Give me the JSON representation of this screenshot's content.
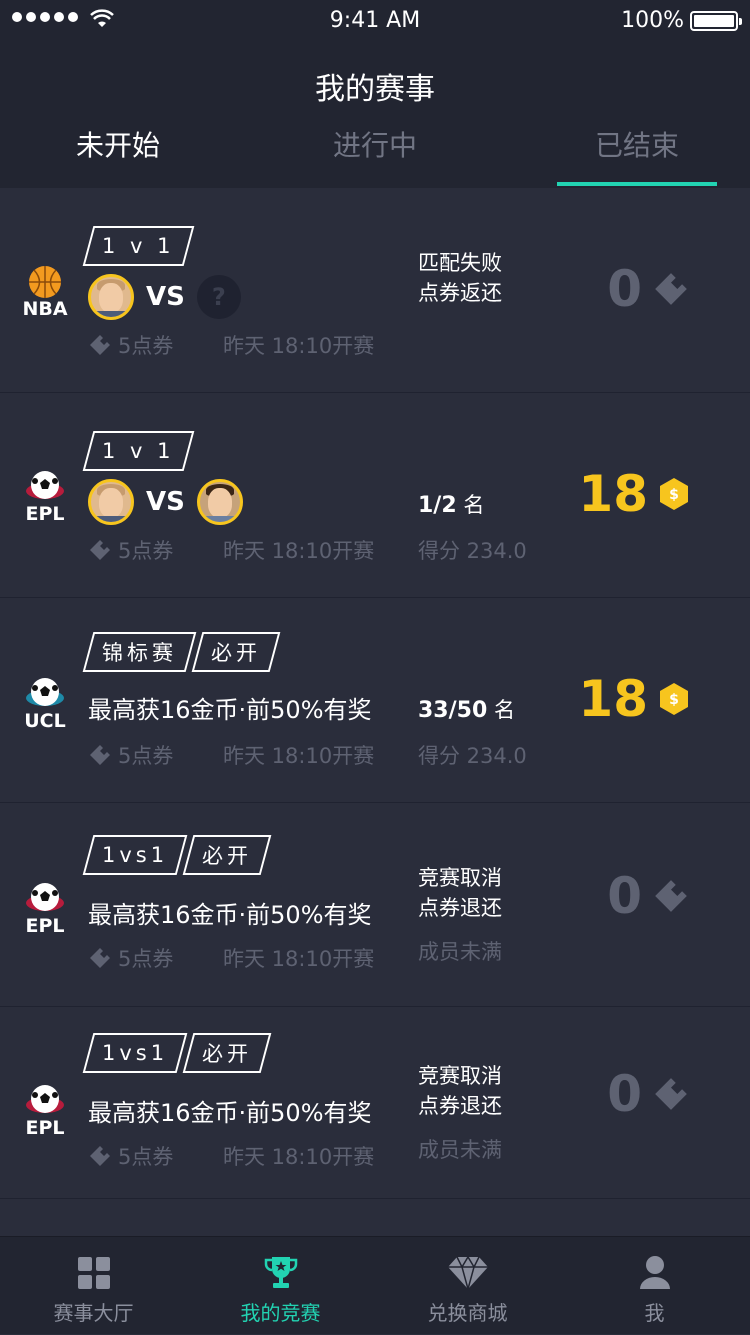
{
  "status": {
    "time": "9:41 AM",
    "battery": "100%"
  },
  "header": {
    "title": "我的赛事"
  },
  "tabs": [
    {
      "label": "未开始"
    },
    {
      "label": "进行中"
    },
    {
      "label": "已结束"
    }
  ],
  "rows": [
    {
      "league": "NBA",
      "tags": [
        "1 v 1"
      ],
      "players": "VS",
      "ticket": "5点券",
      "time": "昨天 18:10开赛",
      "result_line1": "匹配失败",
      "result_line2": "点券返还",
      "reward": "0"
    },
    {
      "league": "EPL",
      "tags": [
        "1 v 1"
      ],
      "players": "VS",
      "ticket": "5点券",
      "time": "昨天 18:10开赛",
      "rank": "1/2",
      "rank_unit": "名",
      "score": "得分 234.0",
      "reward": "18",
      "coin_symbol": "$"
    },
    {
      "league": "UCL",
      "tags": [
        "锦标赛",
        "必开"
      ],
      "prize": "最高获16金币·前50%有奖",
      "ticket": "5点券",
      "time": "昨天 18:10开赛",
      "rank": "33/50",
      "rank_unit": "名",
      "score": "得分 234.0",
      "reward": "18",
      "coin_symbol": "$"
    },
    {
      "league": "EPL",
      "tags": [
        "1vs1",
        "必开"
      ],
      "prize": "最高获16金币·前50%有奖",
      "ticket": "5点券",
      "time": "昨天 18:10开赛",
      "result_line1": "竞赛取消",
      "result_line2": "点券退还",
      "result_line3": "成员未满",
      "reward": "0"
    },
    {
      "league": "EPL",
      "tags": [
        "1vs1",
        "必开"
      ],
      "prize": "最高获16金币·前50%有奖",
      "ticket": "5点券",
      "time": "昨天 18:10开赛",
      "result_line1": "竞赛取消",
      "result_line2": "点券退还",
      "result_line3": "成员未满",
      "reward": "0"
    }
  ],
  "tabbar": [
    {
      "label": "赛事大厅",
      "icon": "grid-icon"
    },
    {
      "label": "我的竞赛",
      "icon": "trophy-icon"
    },
    {
      "label": "兑换商城",
      "icon": "diamond-icon"
    },
    {
      "label": "我",
      "icon": "user-icon"
    }
  ],
  "colors": {
    "accent": "#22d3b2",
    "gold": "#f7c51e",
    "bg": "#2a2d3b",
    "header": "#222531"
  }
}
